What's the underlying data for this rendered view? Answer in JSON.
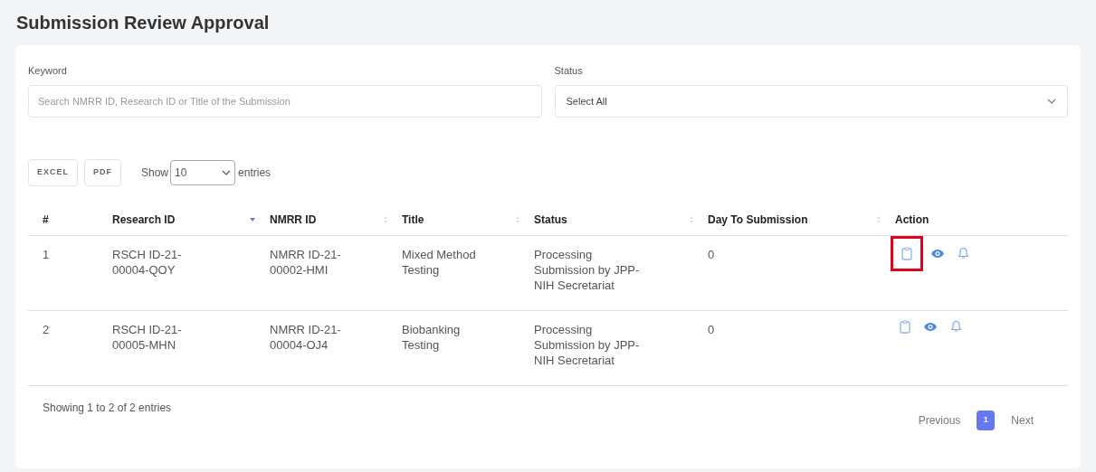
{
  "page_title": "Submission Review Approval",
  "filters": {
    "keyword": {
      "label": "Keyword",
      "placeholder": "Search NMRR ID, Research ID or Title of the Submission"
    },
    "status": {
      "label": "Status",
      "value": "Select All"
    }
  },
  "export_buttons": [
    "EXCEL",
    "PDF"
  ],
  "length_menu": {
    "before": "Show",
    "value": "10",
    "after": "entries"
  },
  "table": {
    "columns": [
      {
        "label": "#"
      },
      {
        "label": "Research ID",
        "sorted": true
      },
      {
        "label": "NMRR ID",
        "sorted": false
      },
      {
        "label": "Title",
        "sorted": false
      },
      {
        "label": "Status",
        "sorted": false
      },
      {
        "label": "Day To Submission",
        "sorted": false
      },
      {
        "label": "Action"
      }
    ],
    "rows": [
      {
        "cells": [
          "1",
          "RSCH ID-21-00004-QOY",
          "NMRR ID-21-00002-HMI",
          "Mixed Method Testing",
          "Processing Submission by JPP-NIH Secretariat",
          "0"
        ],
        "highlighted": true
      },
      {
        "cells": [
          "2",
          "RSCH ID-21-00005-MHN",
          "NMRR ID-21-00004-OJ4",
          "Biobanking Testing",
          "Processing Submission by JPP-NIH Secretariat",
          "0"
        ],
        "highlighted": false
      }
    ]
  },
  "info": "Showing 1 to 2 of 2 entries",
  "pagination": [
    {
      "label": "Previous",
      "selected": false
    },
    {
      "label": "1",
      "selected": true
    },
    {
      "label": "Next",
      "selected": false
    }
  ]
}
